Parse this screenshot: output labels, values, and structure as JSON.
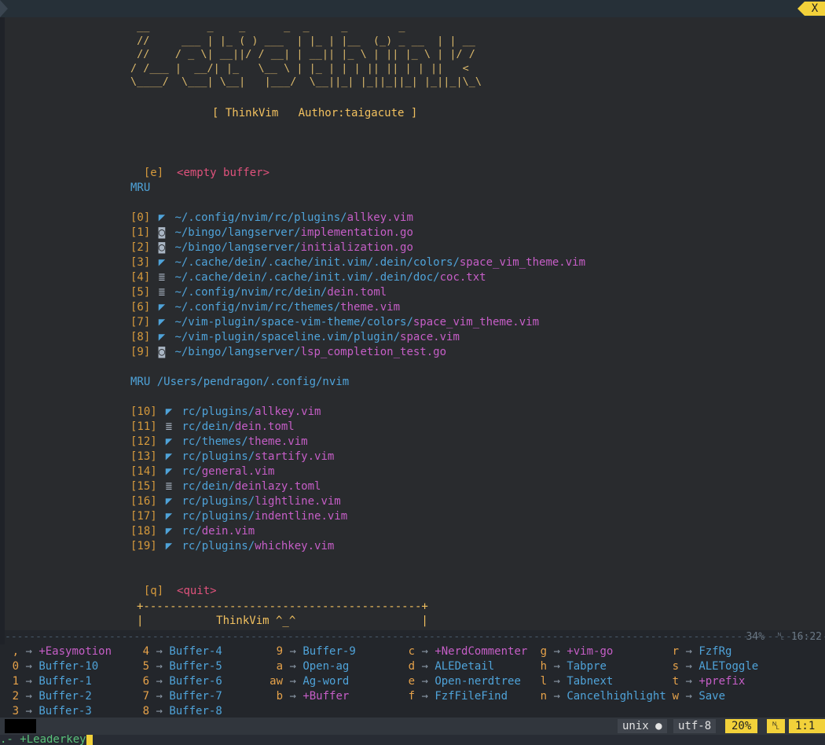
{
  "tabline": {
    "close_label": "X"
  },
  "startify": {
    "ascii_art": " __         _    _      _  _     _        _   \n //     ___ | |_ ( ) ___  | |_ | |__  (_) _ __  | | __\n //    / _ \\| __||/ / __| | __|| |_ \\ | || |_ \\ | |/ /\n/ /___ |  __/| |_   \\__ \\ | |_ | | | || || | | ||   <\n\\____/  \\___| \\__|   |___/  \\__||_| |_||_||_| |_||_|\\_\\",
    "header": "[ ThinkVim   Author:taigacute ]",
    "empty_key": "[e]",
    "empty_label": "<empty buffer>",
    "mru_title": "MRU",
    "mru_items": [
      {
        "key": "[0]",
        "icon": "vim",
        "dir": "~/.config/nvim/rc/plugins/",
        "file": "allkey.vim"
      },
      {
        "key": "[1]",
        "icon": "go",
        "dir": "~/bingo/langserver/",
        "file": "implementation.go"
      },
      {
        "key": "[2]",
        "icon": "go",
        "dir": "~/bingo/langserver/",
        "file": "initialization.go"
      },
      {
        "key": "[3]",
        "icon": "vim",
        "dir": "~/.cache/dein/.cache/init.vim/.dein/colors/",
        "file": "space_vim_theme.vim"
      },
      {
        "key": "[4]",
        "icon": "txt",
        "dir": "~/.cache/dein/.cache/init.vim/.dein/doc/",
        "file": "coc.txt"
      },
      {
        "key": "[5]",
        "icon": "txt",
        "dir": "~/.config/nvim/rc/dein/",
        "file": "dein.toml"
      },
      {
        "key": "[6]",
        "icon": "vim",
        "dir": "~/.config/nvim/rc/themes/",
        "file": "theme.vim"
      },
      {
        "key": "[7]",
        "icon": "vim",
        "dir": "~/vim-plugin/space-vim-theme/colors/",
        "file": "space_vim_theme.vim"
      },
      {
        "key": "[8]",
        "icon": "vim",
        "dir": "~/vim-plugin/spaceline.vim/plugin/",
        "file": "space.vim"
      },
      {
        "key": "[9]",
        "icon": "go",
        "dir": "~/bingo/langserver/",
        "file": "lsp_completion_test.go"
      }
    ],
    "mru_dir_title": "MRU /Users/pendragon/.config/nvim",
    "mru_dir_items": [
      {
        "key": "[10]",
        "icon": "vim",
        "dir": "rc/plugins/",
        "file": "allkey.vim"
      },
      {
        "key": "[11]",
        "icon": "txt",
        "dir": "rc/dein/",
        "file": "dein.toml"
      },
      {
        "key": "[12]",
        "icon": "vim",
        "dir": "rc/themes/",
        "file": "theme.vim"
      },
      {
        "key": "[13]",
        "icon": "vim",
        "dir": "rc/plugins/",
        "file": "startify.vim"
      },
      {
        "key": "[14]",
        "icon": "vim",
        "dir": "rc/",
        "file": "general.vim"
      },
      {
        "key": "[15]",
        "icon": "txt",
        "dir": "rc/dein/",
        "file": "deinlazy.toml"
      },
      {
        "key": "[16]",
        "icon": "vim",
        "dir": "rc/plugins/",
        "file": "lightline.vim"
      },
      {
        "key": "[17]",
        "icon": "vim",
        "dir": "rc/plugins/",
        "file": "indentline.vim"
      },
      {
        "key": "[18]",
        "icon": "vim",
        "dir": "rc/",
        "file": "dein.vim"
      },
      {
        "key": "[19]",
        "icon": "vim",
        "dir": "rc/plugins/",
        "file": "whichkey.vim"
      }
    ],
    "quit_key": "[q]",
    "quit_label": "<quit>",
    "footer_top": "+------------------------------------------+",
    "footer_mid": "|           ThinkVim ^_^                   |"
  },
  "separator": {
    "percent": "34%",
    "lnmark": "␤",
    "position": "16:22"
  },
  "whichkey": {
    "columns": [
      [
        {
          "key": ",",
          "desc": "+Easymotion",
          "group": true
        },
        {
          "key": "0",
          "desc": "Buffer-10",
          "group": false
        },
        {
          "key": "1",
          "desc": "Buffer-1",
          "group": false
        },
        {
          "key": "2",
          "desc": "Buffer-2",
          "group": false
        },
        {
          "key": "3",
          "desc": "Buffer-3",
          "group": false
        }
      ],
      [
        {
          "key": "4",
          "desc": "Buffer-4",
          "group": false
        },
        {
          "key": "5",
          "desc": "Buffer-5",
          "group": false
        },
        {
          "key": "6",
          "desc": "Buffer-6",
          "group": false
        },
        {
          "key": "7",
          "desc": "Buffer-7",
          "group": false
        },
        {
          "key": "8",
          "desc": "Buffer-8",
          "group": false
        }
      ],
      [
        {
          "key": "9",
          "desc": "Buffer-9",
          "group": false
        },
        {
          "key": "a",
          "desc": "Open-ag",
          "group": false
        },
        {
          "key": "aw",
          "desc": "Ag-word",
          "group": false
        },
        {
          "key": "b",
          "desc": "+Buffer",
          "group": true
        }
      ],
      [
        {
          "key": "c",
          "desc": "+NerdCommenter",
          "group": true
        },
        {
          "key": "d",
          "desc": "ALEDetail",
          "group": false
        },
        {
          "key": "e",
          "desc": "Open-nerdtree",
          "group": false
        },
        {
          "key": "f",
          "desc": "FzfFileFind",
          "group": false
        }
      ],
      [
        {
          "key": "g",
          "desc": "+vim-go",
          "group": true
        },
        {
          "key": "h",
          "desc": "Tabpre",
          "group": false
        },
        {
          "key": "l",
          "desc": "Tabnext",
          "group": false
        },
        {
          "key": "n",
          "desc": "Cancelhighlight",
          "group": false
        }
      ],
      [
        {
          "key": "r",
          "desc": "FzfRg",
          "group": false
        },
        {
          "key": "s",
          "desc": "ALEToggle",
          "group": false
        },
        {
          "key": "t",
          "desc": "+prefix",
          "group": true
        },
        {
          "key": "w",
          "desc": "Save",
          "group": false
        }
      ]
    ],
    "arrow": "→"
  },
  "statusline": {
    "fileformat": "unix",
    "os_icon": "apple-icon",
    "encoding": "utf-8",
    "percent": "20%",
    "lnmark": "␤",
    "position": "1:1"
  },
  "cmdline": {
    "text": ".- +Leaderkey"
  },
  "colors": {
    "background": "#292b2e",
    "accent": "#f2d13a",
    "path": "#4fa3d9",
    "file": "#c65ec7",
    "key": "#d69a3c"
  }
}
